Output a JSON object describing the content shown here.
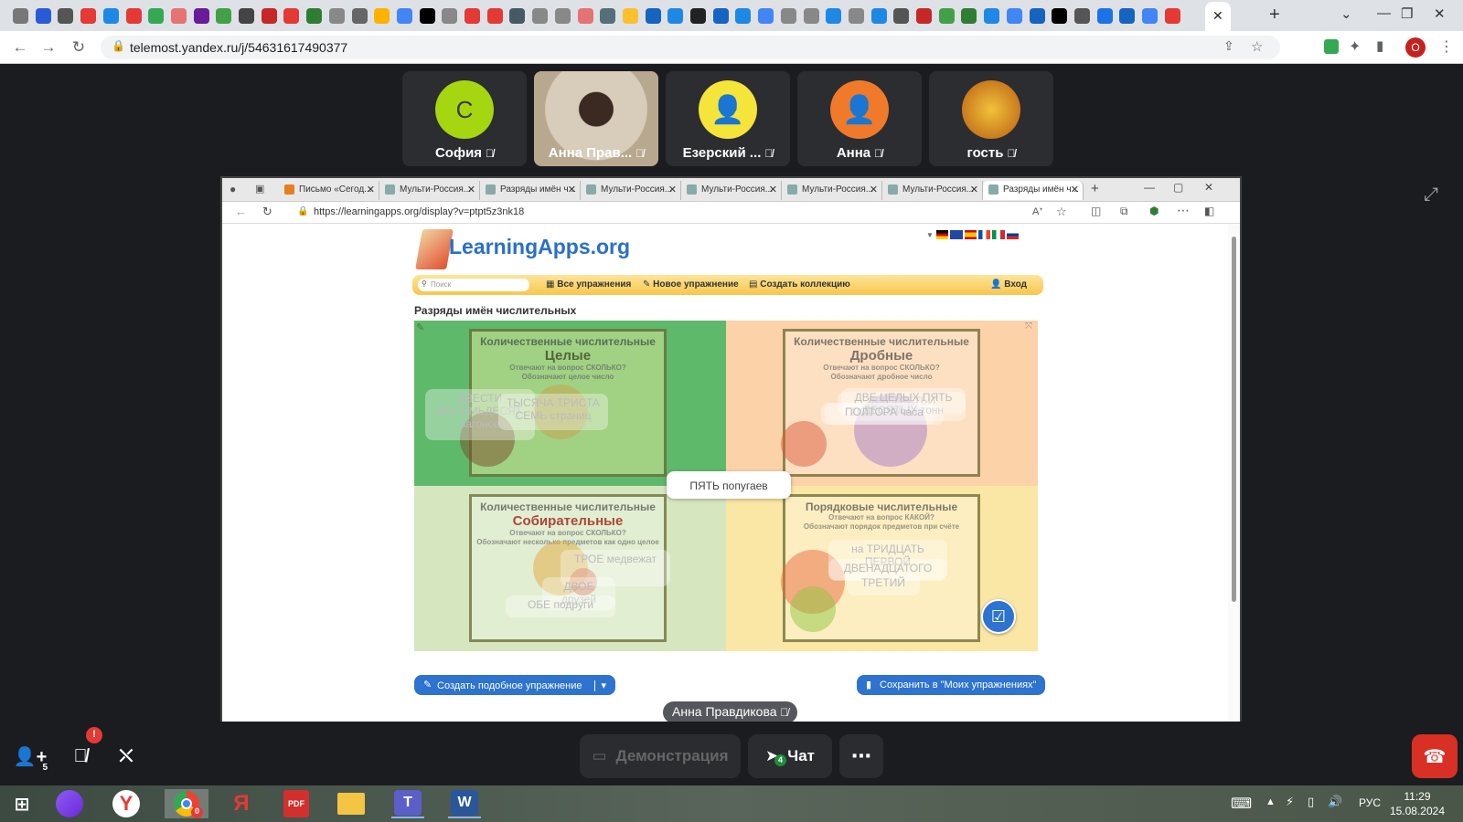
{
  "browser": {
    "url": "telemost.yandex.ru/j/54631617490377",
    "tab_colors": [
      "#777",
      "#2a5bd7",
      "#555",
      "#e53935",
      "#1e88e5",
      "#e53935",
      "#34a853",
      "#e57373",
      "#6a1b9a",
      "#43a047",
      "#444",
      "#c62828",
      "#e53935",
      "#2e7d32",
      "#888",
      "#666",
      "#ffb300",
      "#4285f4",
      "#000",
      "#888",
      "#e53935",
      "#e53935",
      "#455a64",
      "#888",
      "#888",
      "#e57373",
      "#546e7a",
      "#fbc02d",
      "#1565c0",
      "#1e88e5",
      "#222",
      "#1565c0",
      "#1e88e5",
      "#4285f4",
      "#888",
      "#888",
      "#1e88e5",
      "#888",
      "#1e88e5",
      "#555",
      "#c62828",
      "#43a047",
      "#2e7d32",
      "#1e88e5",
      "#4285f4",
      "#1565c0",
      "#000",
      "#555",
      "#1a73e8",
      "#1565c0",
      "#4285f4",
      "#e53935"
    ],
    "profile_initial": "О"
  },
  "participants": [
    {
      "name": "София",
      "initial": "С",
      "color": "#a5d610",
      "kind": "initial"
    },
    {
      "name": "Анна Прав...",
      "initial": "",
      "color": "#c9b8a0",
      "kind": "video"
    },
    {
      "name": "Езерский ...",
      "initial": "",
      "color": "#f5e43a",
      "kind": "person"
    },
    {
      "name": "Анна",
      "initial": "",
      "color": "#f07a2a",
      "kind": "person"
    },
    {
      "name": "гость",
      "initial": "",
      "color": "#d68a1a",
      "kind": "photo"
    }
  ],
  "edge": {
    "url": "https://learningapps.org/display?v=ptpt5z3nk18",
    "tabs": [
      "Письмо «Сегод...",
      "Мульти-Россия...",
      "Разряды имён ч...",
      "Мульти-Россия...",
      "Мульти-Россия...",
      "Мульти-Россия...",
      "Мульти-Россия...",
      "Разряды имён ч..."
    ]
  },
  "learningapps": {
    "logo": "LearningApps.org",
    "search_placeholder": "Поиск",
    "nav": [
      "Все упражнения",
      "Новое упражнение",
      "Создать коллекцию"
    ],
    "login": "Вход",
    "title": "Разряды имён числительных",
    "quadrants": [
      {
        "heading": "Количественные числительные",
        "sub": "Целые",
        "q1": "Отвечают на вопрос СКОЛЬКО?",
        "q2": "Обозначают целое число",
        "bg": "#5fb96a",
        "sub_color": "#4a4a2a",
        "chips": [
          "ДВЕСТИ ВОСЕМЬДЕСЯТ вагонов",
          "ТЫСЯЧА ТРИСТА СЕМЬ страниц"
        ]
      },
      {
        "heading": "Количественные числительные",
        "sub": "Дробные",
        "q1": "Отвечают на вопрос СКОЛЬКО?",
        "q2": "Обозначают дробное число",
        "bg": "#fcd3a8",
        "sub_color": "#555",
        "chips": [
          "ДВЕ ТРЕТЬИ",
          "ПОЛТОРА",
          "ДВЕ ЦЕЛЫХ ПЯТЬ ДЕСЯТЫХ тонн",
          "ПОЛТОРА часа"
        ]
      },
      {
        "heading": "Количественные числительные",
        "sub": "Собирательные",
        "q1": "Отвечают на вопрос СКОЛЬКО?",
        "q2": "Обозначают несколько предметов как одно целое",
        "bg": "#d6e6bf",
        "sub_color": "#a01010",
        "chips": [
          "ТРОЕ медвежат",
          "ДВОЕ друзей",
          "ОБЕ подруги"
        ]
      },
      {
        "heading": "Порядковые числительные",
        "sub": "",
        "q1": "Отвечают на вопрос КАКОЙ?",
        "q2": "Обозначают порядок предметов при счёте",
        "bg": "#fbe7a5",
        "sub_color": "#555",
        "chips": [
          "на ТРИДЦАТЬ ПЕРВОЙ",
          "ДВЕНАДЦАТОГО",
          "ТРЕТИЙ"
        ]
      }
    ],
    "drag_item": "ПЯТЬ попугаев",
    "create_similar": "Создать подобное упражнение",
    "save": "Сохранить в \"Моих упражнениях\""
  },
  "speaker": "Анна Правдикова",
  "controls": {
    "add_badge": "5",
    "mic_badge": "!",
    "demo": "Демонстрация",
    "chat": "Чат",
    "chat_badge": "4"
  },
  "taskbar": {
    "lang": "РУС",
    "time": "11:29",
    "date": "15.08.2024",
    "chrome_badge": "0"
  }
}
